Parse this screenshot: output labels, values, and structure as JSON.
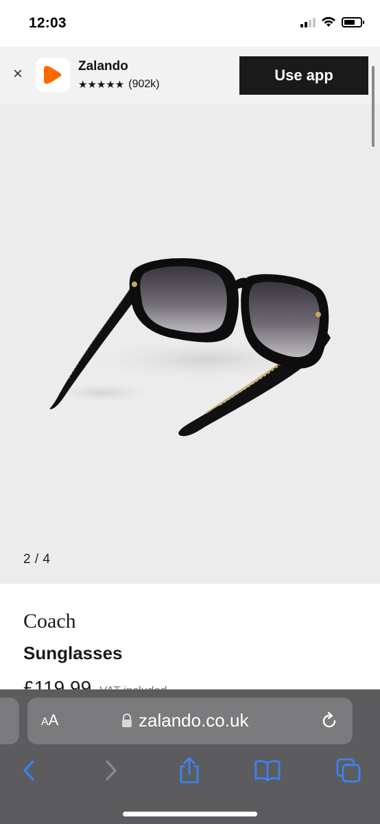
{
  "status_bar": {
    "time": "12:03"
  },
  "app_banner": {
    "close_glyph": "×",
    "app_name": "Zalando",
    "stars": "★★★★★",
    "rating_count": "(902k)",
    "cta_label": "Use app",
    "app_icon_color": "#ff6900",
    "icon": "zalando-logo-icon"
  },
  "gallery": {
    "counter": "2 / 4",
    "background": "#ececec"
  },
  "product": {
    "brand": "Coach",
    "name": "Sunglasses",
    "price": "£119.99",
    "vat_note": "VAT included"
  },
  "browser": {
    "aa_label_small": "A",
    "aa_label_large": "A",
    "url": "zalando.co.uk",
    "toolbar_icons": [
      "back-icon",
      "forward-icon",
      "share-icon",
      "bookmarks-icon",
      "tabs-icon"
    ],
    "accent": "#3a82f7"
  }
}
